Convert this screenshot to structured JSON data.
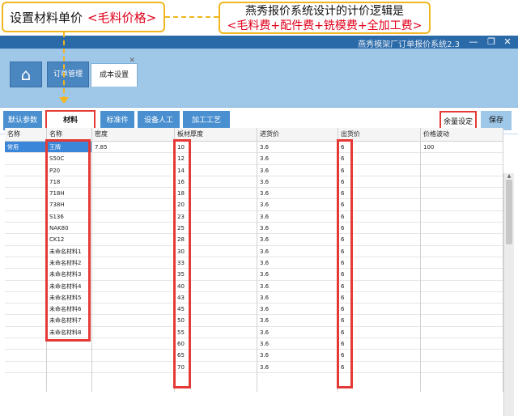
{
  "annotation": {
    "left_black": "设置材料单价",
    "left_red": "<毛料价格>",
    "right_line1": "燕秀报价系统设计的计价逻辑是",
    "right_line2": "<毛料费+配件费+铣模费+全加工费>"
  },
  "window": {
    "title": "燕秀模架厂订单报价系统2.3",
    "controls": {
      "minimize": "—",
      "restore": "❐",
      "close": "✕"
    }
  },
  "tabs": {
    "home_icon": "home-icon",
    "main": "订单管理",
    "active": "成本设置",
    "close": "✕"
  },
  "subtabs": [
    "默认参数",
    "材料",
    "标准件",
    "设备人工",
    "加工工艺"
  ],
  "buttons": {
    "yuliang": "余量设定",
    "save": "保存"
  },
  "grid": {
    "col0": {
      "header": "名称",
      "rows": [
        "常用"
      ]
    },
    "col1": {
      "header": "名称",
      "rows": [
        "王牌",
        "S50C",
        "P20",
        "718",
        "718H",
        "738H",
        "S136",
        "NAK80",
        "CK12",
        "未命名材料1",
        "未命名材料2",
        "未命名材料3",
        "未命名材料4",
        "未命名材料5",
        "未命名材料6",
        "未命名材料7",
        "未命名材料8",
        "",
        "",
        ""
      ]
    },
    "col2": {
      "header": "密度",
      "rows": [
        "7.85"
      ]
    },
    "col3": {
      "header": "板材厚度",
      "rows": [
        "10",
        "12",
        "14",
        "16",
        "18",
        "20",
        "23",
        "25",
        "28",
        "30",
        "33",
        "35",
        "40",
        "43",
        "45",
        "50",
        "55",
        "60",
        "65",
        "70"
      ]
    },
    "col4": {
      "header": "进货价",
      "rows": [
        "3.6",
        "3.6",
        "3.6",
        "3.6",
        "3.6",
        "3.6",
        "3.6",
        "3.6",
        "3.6",
        "3.6",
        "3.6",
        "3.6",
        "3.6",
        "3.6",
        "3.6",
        "3.6",
        "3.6",
        "3.6",
        "3.6",
        "3.6"
      ]
    },
    "col5": {
      "header": "出货价",
      "rows": [
        "6",
        "6",
        "6",
        "6",
        "6",
        "6",
        "6",
        "6",
        "6",
        "6",
        "6",
        "6",
        "6",
        "6",
        "6",
        "6",
        "6",
        "6",
        "6",
        "6"
      ]
    },
    "col6": {
      "header": "价格波动",
      "rows": [
        "100"
      ]
    }
  },
  "colors": {
    "accent": "#4a90d0",
    "highlight": "#e53935",
    "annotation": "#f2b620",
    "titlebar": "#2b6aa8"
  }
}
